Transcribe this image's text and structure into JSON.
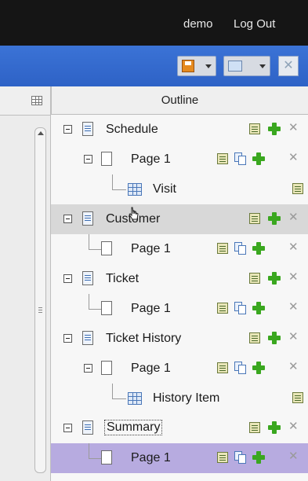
{
  "header": {
    "user": "demo",
    "logout_label": "Log Out"
  },
  "toolbar": {
    "save_icon": "save-icon",
    "view_icon": "view-icon",
    "close_icon": "close-icon"
  },
  "outline": {
    "title": "Outline",
    "items": [
      {
        "label": "Schedule"
      },
      {
        "label": "Page 1"
      },
      {
        "label": "Visit"
      },
      {
        "label": "Customer"
      },
      {
        "label": "Page 1"
      },
      {
        "label": "Ticket"
      },
      {
        "label": "Page 1"
      },
      {
        "label": "Ticket History"
      },
      {
        "label": "Page 1"
      },
      {
        "label": "History Item"
      },
      {
        "label": "Summary"
      },
      {
        "label": "Page 1"
      }
    ]
  },
  "colors": {
    "toolbar_blue": "#2e62c6",
    "selected_row": "#b7abe0",
    "hover_row": "#d8d8d8",
    "add_green": "#3aa71f"
  }
}
